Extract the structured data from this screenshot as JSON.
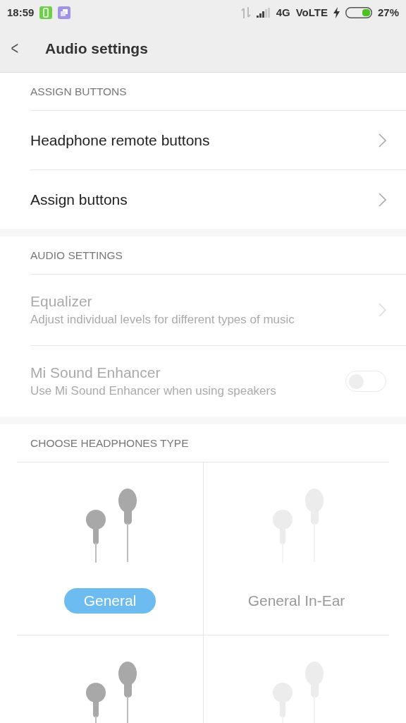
{
  "status_bar": {
    "time": "18:59",
    "network": "4G",
    "volte": "VoLTE",
    "battery_text": "27%"
  },
  "header": {
    "back": "<",
    "title": "Audio settings"
  },
  "sections": [
    {
      "title": "ASSIGN BUTTONS",
      "items": [
        {
          "kind": "link",
          "label": "Headphone remote buttons",
          "disabled": false
        },
        {
          "kind": "link",
          "label": "Assign buttons",
          "disabled": false
        }
      ]
    },
    {
      "title": "AUDIO SETTINGS",
      "items": [
        {
          "kind": "link",
          "label": "Equalizer",
          "summary": "Adjust individual levels for different types of music",
          "disabled": true
        },
        {
          "kind": "toggle",
          "label": "Mi Sound Enhancer",
          "summary": "Use Mi Sound Enhancer when using speakers",
          "disabled": true,
          "on": false
        }
      ]
    }
  ],
  "headphones": {
    "title": "CHOOSE HEADPHONES TYPE",
    "types": [
      {
        "label": "General",
        "selected": true
      },
      {
        "label": "General In-Ear",
        "selected": false
      },
      {
        "selected": false
      },
      {
        "selected": false
      }
    ]
  }
}
